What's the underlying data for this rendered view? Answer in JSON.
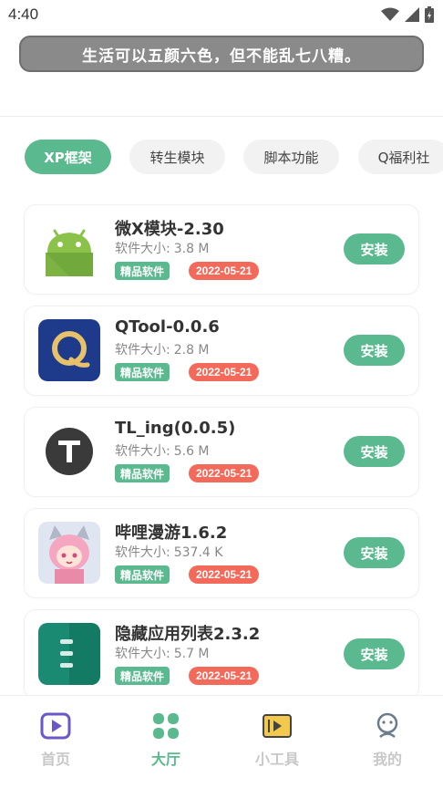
{
  "status_bar": {
    "time": "4:40"
  },
  "banner": {
    "text": "生活可以五颜六色，但不能乱七八糟。"
  },
  "tabs": [
    {
      "label": "XP框架",
      "active": true
    },
    {
      "label": "转生模块",
      "active": false
    },
    {
      "label": "脚本功能",
      "active": false
    },
    {
      "label": "Q福利社",
      "active": false
    }
  ],
  "apps": [
    {
      "name": "微X模块-2.30",
      "size_label": "软件大小:",
      "size": "3.8 M",
      "tag": "精品软件",
      "date": "2022-05-21",
      "button": "安装",
      "icon": "android-icon"
    },
    {
      "name": "QTool-0.0.6",
      "size_label": "软件大小:",
      "size": "2.8 M",
      "tag": "精品软件",
      "date": "2022-05-21",
      "button": "安装",
      "icon": "qtool-icon"
    },
    {
      "name": "TL_ing(0.0.5)",
      "size_label": "软件大小:",
      "size": "5.6 M",
      "tag": "精品软件",
      "date": "2022-05-21",
      "button": "安装",
      "icon": "tl-ing-icon"
    },
    {
      "name": "哔哩漫游1.6.2",
      "size_label": "软件大小:",
      "size": "537.4 K",
      "tag": "精品软件",
      "date": "2022-05-21",
      "button": "安装",
      "icon": "anime-girl-icon"
    },
    {
      "name": "隐藏应用列表2.3.2",
      "size_label": "软件大小:",
      "size": "5.7 M",
      "tag": "精品软件",
      "date": "2022-05-21",
      "button": "安装",
      "icon": "hide-app-list-icon"
    }
  ],
  "bottom_nav": [
    {
      "label": "首页",
      "icon": "play-icon",
      "active": false
    },
    {
      "label": "大厅",
      "icon": "grid-icon",
      "active": true
    },
    {
      "label": "小工具",
      "icon": "video-tool-icon",
      "active": false
    },
    {
      "label": "我的",
      "icon": "user-icon",
      "active": false
    }
  ],
  "colors": {
    "accent": "#5ab98e",
    "date_badge": "#f46a5a",
    "banner_bg": "#8a8a8a"
  }
}
